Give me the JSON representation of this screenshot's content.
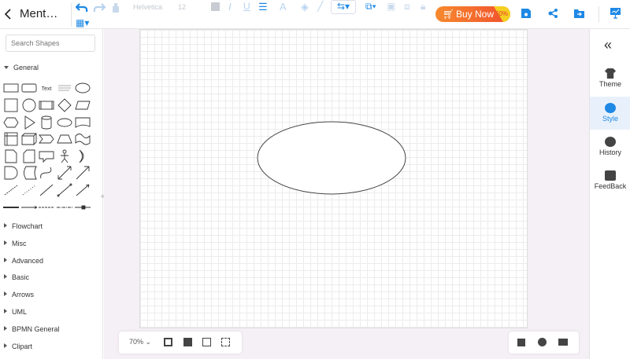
{
  "header": {
    "title": "Ment…",
    "font": "Helvetica",
    "font_size": "12",
    "buy_label": "Buy Now",
    "discount": "-60%"
  },
  "sidebar": {
    "search_placeholder": "Search Shapes",
    "open_category": "General",
    "categories": [
      "Flowchart",
      "Misc",
      "Advanced",
      "Basic",
      "Arrows",
      "UML",
      "BPMN General",
      "Clipart"
    ],
    "text_shape_label": "Text"
  },
  "right_panel": {
    "items": [
      {
        "label": "Theme"
      },
      {
        "label": "Style"
      },
      {
        "label": "History"
      },
      {
        "label": "FeedBack"
      }
    ],
    "active": "Style"
  },
  "bottom": {
    "zoom": "70%"
  },
  "colors": {
    "accent": "#1e88e5",
    "buy_start": "#f78a2d",
    "buy_end": "#f0502f"
  }
}
